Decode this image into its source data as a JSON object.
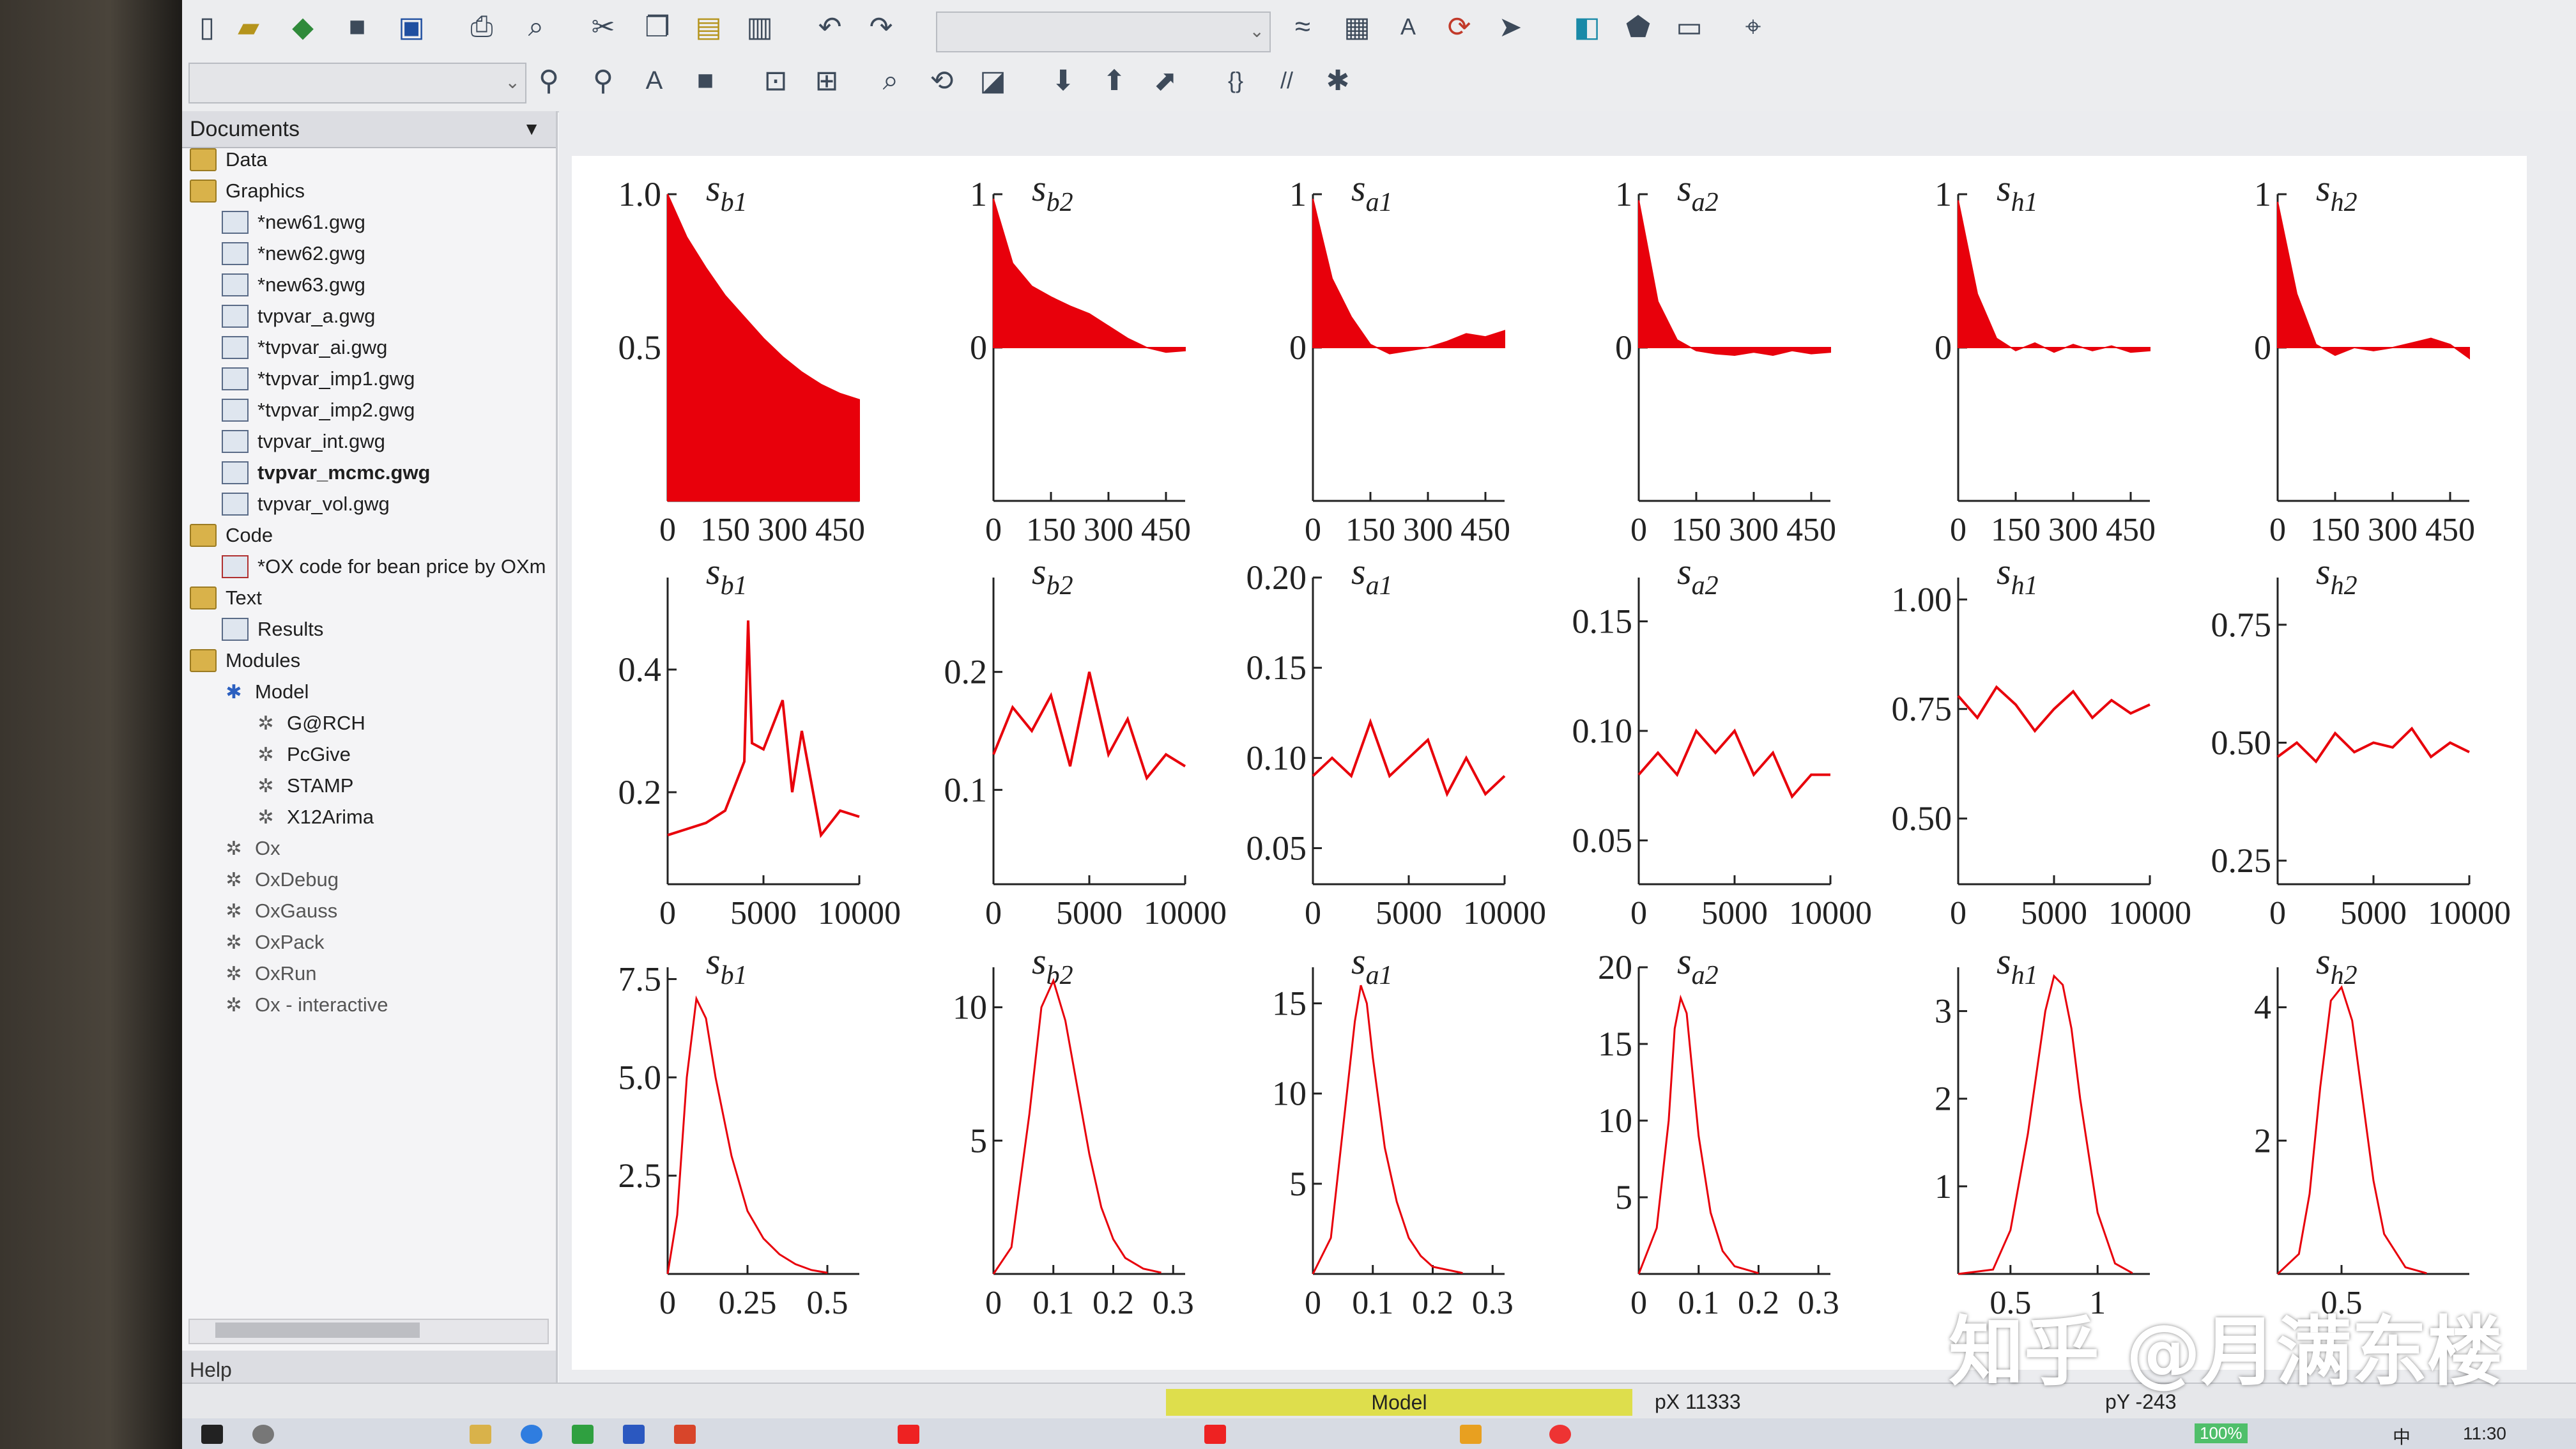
{
  "left_panel": {
    "header": "Documents",
    "items": [
      {
        "label": "Data",
        "type": "folder",
        "indent": 0
      },
      {
        "label": "Graphics",
        "type": "folder",
        "indent": 0
      },
      {
        "label": "*new61.gwg",
        "type": "gwg",
        "indent": 1
      },
      {
        "label": "*new62.gwg",
        "type": "gwg",
        "indent": 1
      },
      {
        "label": "*new63.gwg",
        "type": "gwg",
        "indent": 1
      },
      {
        "label": "tvpvar_a.gwg",
        "type": "gwg",
        "indent": 1
      },
      {
        "label": "*tvpvar_ai.gwg",
        "type": "gwg",
        "indent": 1
      },
      {
        "label": "*tvpvar_imp1.gwg",
        "type": "gwg",
        "indent": 1
      },
      {
        "label": "*tvpvar_imp2.gwg",
        "type": "gwg",
        "indent": 1
      },
      {
        "label": "tvpvar_int.gwg",
        "type": "gwg",
        "indent": 1
      },
      {
        "label": "tvpvar_mcmc.gwg",
        "type": "gwg",
        "indent": 1,
        "bold": true
      },
      {
        "label": "tvpvar_vol.gwg",
        "type": "gwg",
        "indent": 1
      },
      {
        "label": "Code",
        "type": "folder",
        "indent": 0
      },
      {
        "label": "*OX code for bean price by OXm",
        "type": "code",
        "indent": 1
      },
      {
        "label": "Text",
        "type": "folder",
        "indent": 0
      },
      {
        "label": "Results",
        "type": "text",
        "indent": 1
      },
      {
        "label": "Modules",
        "type": "folder",
        "indent": 0
      },
      {
        "label": "Model",
        "type": "model",
        "indent": 1
      },
      {
        "label": "G@RCH",
        "type": "mod",
        "indent": 2
      },
      {
        "label": "PcGive",
        "type": "mod",
        "indent": 2
      },
      {
        "label": "STAMP",
        "type": "mod",
        "indent": 2
      },
      {
        "label": "X12Arima",
        "type": "mod",
        "indent": 2
      },
      {
        "label": "Ox",
        "type": "mod",
        "indent": 1,
        "gray": true
      },
      {
        "label": "OxDebug",
        "type": "mod",
        "indent": 1,
        "gray": true
      },
      {
        "label": "OxGauss",
        "type": "mod",
        "indent": 1,
        "gray": true
      },
      {
        "label": "OxPack",
        "type": "mod",
        "indent": 1,
        "gray": true
      },
      {
        "label": "OxRun",
        "type": "mod",
        "indent": 1,
        "gray": true
      },
      {
        "label": "Ox - interactive",
        "type": "mod",
        "indent": 1,
        "gray": true
      }
    ],
    "help_label": "Help"
  },
  "status": {
    "mode": "Model",
    "px": "pX 11333",
    "py": "pY  -243"
  },
  "taskbar": {
    "battery": "100%",
    "ime": "中",
    "clock": "11:30"
  },
  "watermark": "知乎 @月满东楼",
  "icons": [
    "new-doc-icon",
    "open-folder-icon",
    "open-data-icon",
    "close-icon",
    "save-icon",
    "print-icon",
    "print-preview-icon",
    "cut-icon",
    "copy-icon",
    "paste-icon",
    "paste-special-icon",
    "undo-icon",
    "redo-icon"
  ],
  "colors": {
    "series": "#e8000b",
    "accent": "#dede4c"
  },
  "chart_data": [
    {
      "type": "area",
      "title": "s_{b1}",
      "xticks": [
        "0",
        "150",
        "300",
        "450"
      ],
      "yticks": [
        "1.0",
        "0.5"
      ],
      "ylim": [
        0,
        1
      ],
      "xlim": [
        0,
        500
      ],
      "x": [
        0,
        50,
        100,
        150,
        200,
        250,
        300,
        350,
        400,
        450,
        500
      ],
      "y": [
        1.0,
        0.86,
        0.76,
        0.67,
        0.6,
        0.53,
        0.47,
        0.42,
        0.38,
        0.35,
        0.33
      ]
    },
    {
      "type": "area",
      "title": "s_{b2}",
      "xticks": [
        "0",
        "150",
        "300",
        "450"
      ],
      "yticks": [
        "1",
        "0"
      ],
      "ylim": [
        -1,
        1
      ],
      "xlim": [
        0,
        500
      ],
      "x": [
        0,
        50,
        100,
        150,
        200,
        250,
        300,
        350,
        400,
        450,
        500
      ],
      "y": [
        0.97,
        0.55,
        0.4,
        0.33,
        0.27,
        0.22,
        0.14,
        0.06,
        0.0,
        -0.03,
        -0.02
      ]
    },
    {
      "type": "area",
      "title": "s_{a1}",
      "xticks": [
        "0",
        "150",
        "300",
        "450"
      ],
      "yticks": [
        "1",
        "0"
      ],
      "ylim": [
        -1,
        1
      ],
      "xlim": [
        0,
        500
      ],
      "x": [
        0,
        50,
        100,
        150,
        200,
        250,
        300,
        350,
        400,
        450,
        500
      ],
      "y": [
        0.97,
        0.45,
        0.2,
        0.02,
        -0.04,
        -0.02,
        0.0,
        0.04,
        0.09,
        0.07,
        0.11
      ]
    },
    {
      "type": "area",
      "title": "s_{a2}",
      "xticks": [
        "0",
        "150",
        "300",
        "450"
      ],
      "yticks": [
        "1",
        "0"
      ],
      "ylim": [
        -1,
        1
      ],
      "xlim": [
        0,
        500
      ],
      "x": [
        0,
        50,
        100,
        150,
        200,
        250,
        300,
        350,
        400,
        450,
        500
      ],
      "y": [
        0.96,
        0.3,
        0.05,
        -0.02,
        -0.04,
        -0.05,
        -0.03,
        -0.05,
        -0.02,
        -0.04,
        -0.03
      ]
    },
    {
      "type": "area",
      "title": "s_{h1}",
      "xticks": [
        "0",
        "150",
        "300",
        "450"
      ],
      "yticks": [
        "1",
        "0"
      ],
      "ylim": [
        -1,
        1
      ],
      "xlim": [
        0,
        500
      ],
      "x": [
        0,
        50,
        100,
        150,
        200,
        250,
        300,
        350,
        400,
        450,
        500
      ],
      "y": [
        0.96,
        0.35,
        0.06,
        -0.02,
        0.03,
        -0.03,
        0.02,
        -0.02,
        0.01,
        -0.03,
        -0.02
      ]
    },
    {
      "type": "area",
      "title": "s_{h2}",
      "xticks": [
        "0",
        "150",
        "300",
        "450"
      ],
      "yticks": [
        "1",
        "0"
      ],
      "ylim": [
        -1,
        1
      ],
      "xlim": [
        0,
        500
      ],
      "x": [
        0,
        50,
        100,
        150,
        200,
        250,
        300,
        350,
        400,
        450,
        500
      ],
      "y": [
        0.95,
        0.35,
        0.02,
        -0.05,
        0.0,
        -0.02,
        0.0,
        0.03,
        0.06,
        0.02,
        -0.07
      ]
    },
    {
      "type": "line",
      "title": "s_{b1}",
      "xticks": [
        "0",
        "5000",
        "10000"
      ],
      "yticks": [
        "0.4",
        "0.2"
      ],
      "ylim": [
        0.05,
        0.55
      ],
      "xlim": [
        0,
        10000
      ],
      "x": [
        0,
        1000,
        2000,
        3000,
        4000,
        4200,
        4400,
        5000,
        6000,
        6500,
        7000,
        8000,
        9000,
        10000
      ],
      "y": [
        0.13,
        0.14,
        0.15,
        0.17,
        0.25,
        0.48,
        0.28,
        0.27,
        0.35,
        0.2,
        0.3,
        0.13,
        0.17,
        0.16
      ]
    },
    {
      "type": "line",
      "title": "s_{b2}",
      "xticks": [
        "0",
        "5000",
        "10000"
      ],
      "yticks": [
        "0.2",
        "0.1"
      ],
      "ylim": [
        0.02,
        0.28
      ],
      "xlim": [
        0,
        10000
      ],
      "x": [
        0,
        1000,
        2000,
        3000,
        4000,
        5000,
        6000,
        7000,
        8000,
        9000,
        10000
      ],
      "y": [
        0.13,
        0.17,
        0.15,
        0.18,
        0.12,
        0.2,
        0.13,
        0.16,
        0.11,
        0.13,
        0.12
      ]
    },
    {
      "type": "line",
      "title": "s_{a1}",
      "xticks": [
        "0",
        "5000",
        "10000"
      ],
      "yticks": [
        "0.20",
        "0.15",
        "0.10",
        "0.05"
      ],
      "ylim": [
        0.03,
        0.2
      ],
      "xlim": [
        0,
        10000
      ],
      "x": [
        0,
        1000,
        2000,
        3000,
        4000,
        5000,
        6000,
        7000,
        8000,
        9000,
        10000
      ],
      "y": [
        0.09,
        0.1,
        0.09,
        0.12,
        0.09,
        0.1,
        0.11,
        0.08,
        0.1,
        0.08,
        0.09
      ]
    },
    {
      "type": "line",
      "title": "s_{a2}",
      "xticks": [
        "0",
        "5000",
        "10000"
      ],
      "yticks": [
        "0.15",
        "0.10",
        "0.05"
      ],
      "ylim": [
        0.03,
        0.17
      ],
      "xlim": [
        0,
        10000
      ],
      "x": [
        0,
        1000,
        2000,
        3000,
        4000,
        5000,
        6000,
        7000,
        8000,
        9000,
        10000
      ],
      "y": [
        0.08,
        0.09,
        0.08,
        0.1,
        0.09,
        0.1,
        0.08,
        0.09,
        0.07,
        0.08,
        0.08
      ]
    },
    {
      "type": "line",
      "title": "s_{h1}",
      "xticks": [
        "0",
        "5000",
        "10000"
      ],
      "yticks": [
        "1.00",
        "0.75",
        "0.50"
      ],
      "ylim": [
        0.35,
        1.05
      ],
      "xlim": [
        0,
        10000
      ],
      "x": [
        0,
        1000,
        2000,
        3000,
        4000,
        5000,
        6000,
        7000,
        8000,
        9000,
        10000
      ],
      "y": [
        0.78,
        0.73,
        0.8,
        0.76,
        0.7,
        0.75,
        0.79,
        0.73,
        0.77,
        0.74,
        0.76
      ]
    },
    {
      "type": "line",
      "title": "s_{h2}",
      "xticks": [
        "0",
        "5000",
        "10000"
      ],
      "yticks": [
        "0.75",
        "0.50",
        "0.25"
      ],
      "ylim": [
        0.2,
        0.85
      ],
      "xlim": [
        0,
        10000
      ],
      "x": [
        0,
        1000,
        2000,
        3000,
        4000,
        5000,
        6000,
        7000,
        8000,
        9000,
        10000
      ],
      "y": [
        0.47,
        0.5,
        0.46,
        0.52,
        0.48,
        0.5,
        0.49,
        0.53,
        0.47,
        0.5,
        0.48
      ]
    },
    {
      "type": "line",
      "title": "s_{b1}",
      "xticks": [
        "0",
        "0.25",
        "0.5"
      ],
      "yticks": [
        "7.5",
        "5.0",
        "2.5"
      ],
      "ylim": [
        0,
        7.8
      ],
      "xlim": [
        0,
        0.6
      ],
      "x": [
        0,
        0.03,
        0.06,
        0.09,
        0.12,
        0.15,
        0.2,
        0.25,
        0.3,
        0.35,
        0.4,
        0.45,
        0.5
      ],
      "y": [
        0,
        1.5,
        5.0,
        7.0,
        6.5,
        5.0,
        3.0,
        1.6,
        0.9,
        0.5,
        0.25,
        0.1,
        0.03
      ]
    },
    {
      "type": "line",
      "title": "s_{b2}",
      "xticks": [
        "0",
        "0.1",
        "0.2",
        "0.3"
      ],
      "yticks": [
        "10",
        "5"
      ],
      "ylim": [
        0,
        11.5
      ],
      "xlim": [
        0,
        0.32
      ],
      "x": [
        0,
        0.03,
        0.06,
        0.08,
        0.1,
        0.12,
        0.14,
        0.16,
        0.18,
        0.2,
        0.22,
        0.25,
        0.28
      ],
      "y": [
        0,
        1.0,
        6.0,
        10.0,
        11.0,
        9.5,
        7.0,
        4.5,
        2.5,
        1.3,
        0.6,
        0.2,
        0.05
      ]
    },
    {
      "type": "line",
      "title": "s_{a1}",
      "xticks": [
        "0",
        "0.1",
        "0.2",
        "0.3"
      ],
      "yticks": [
        "15",
        "10",
        "5"
      ],
      "ylim": [
        0,
        17
      ],
      "xlim": [
        0,
        0.32
      ],
      "x": [
        0,
        0.03,
        0.05,
        0.07,
        0.08,
        0.09,
        0.1,
        0.12,
        0.14,
        0.16,
        0.18,
        0.2,
        0.25
      ],
      "y": [
        0,
        2.0,
        8.0,
        14.0,
        16.0,
        15.0,
        12.0,
        7.0,
        4.0,
        2.0,
        1.0,
        0.4,
        0.05
      ]
    },
    {
      "type": "line",
      "title": "s_{a2}",
      "xticks": [
        "0",
        "0.1",
        "0.2",
        "0.3"
      ],
      "yticks": [
        "20",
        "15",
        "10",
        "5"
      ],
      "ylim": [
        0,
        20
      ],
      "xlim": [
        0,
        0.32
      ],
      "x": [
        0,
        0.03,
        0.05,
        0.06,
        0.07,
        0.08,
        0.09,
        0.1,
        0.12,
        0.14,
        0.16,
        0.2
      ],
      "y": [
        0,
        3.0,
        10.0,
        16.0,
        18.0,
        17.0,
        13.0,
        9.0,
        4.0,
        1.5,
        0.5,
        0.05
      ]
    },
    {
      "type": "line",
      "title": "s_{h1}",
      "xticks": [
        "0.5",
        "1"
      ],
      "yticks": [
        "3",
        "2",
        "1"
      ],
      "ylim": [
        0,
        3.5
      ],
      "xlim": [
        0.2,
        1.3
      ],
      "x": [
        0.2,
        0.4,
        0.5,
        0.6,
        0.7,
        0.75,
        0.8,
        0.85,
        0.9,
        1.0,
        1.1,
        1.2
      ],
      "y": [
        0,
        0.05,
        0.5,
        1.6,
        3.0,
        3.4,
        3.3,
        2.8,
        2.0,
        0.7,
        0.12,
        0.01
      ]
    },
    {
      "type": "line",
      "title": "s_{h2}",
      "xticks": [
        "0.5"
      ],
      "yticks": [
        "4",
        "2"
      ],
      "ylim": [
        0,
        4.6
      ],
      "xlim": [
        0.2,
        1.1
      ],
      "x": [
        0.2,
        0.3,
        0.35,
        0.4,
        0.45,
        0.5,
        0.55,
        0.6,
        0.65,
        0.7,
        0.8,
        0.9
      ],
      "y": [
        0,
        0.3,
        1.2,
        2.8,
        4.1,
        4.3,
        3.8,
        2.6,
        1.4,
        0.6,
        0.1,
        0.01
      ]
    }
  ]
}
